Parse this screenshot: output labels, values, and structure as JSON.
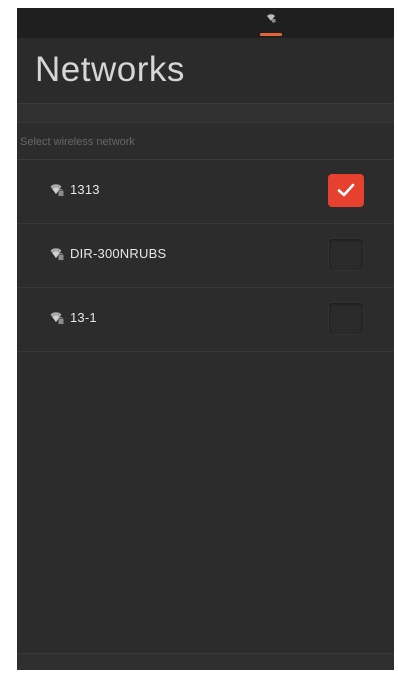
{
  "status_bar": {
    "active_indicator_icon": "wifi-icon",
    "indicator_color": "#e0633a"
  },
  "header": {
    "title": "Networks"
  },
  "section": {
    "label": "Select wireless network"
  },
  "networks": [
    {
      "name": "1313",
      "icon": "wifi-secure-icon",
      "selected": true
    },
    {
      "name": "DIR-300NRUBS",
      "icon": "wifi-secure-icon",
      "selected": false
    },
    {
      "name": "13-1",
      "icon": "wifi-secure-icon",
      "selected": false
    }
  ],
  "colors": {
    "background": "#2c2c2c",
    "checkbox_checked": "#e6412e",
    "text": "#e6e6e6"
  }
}
